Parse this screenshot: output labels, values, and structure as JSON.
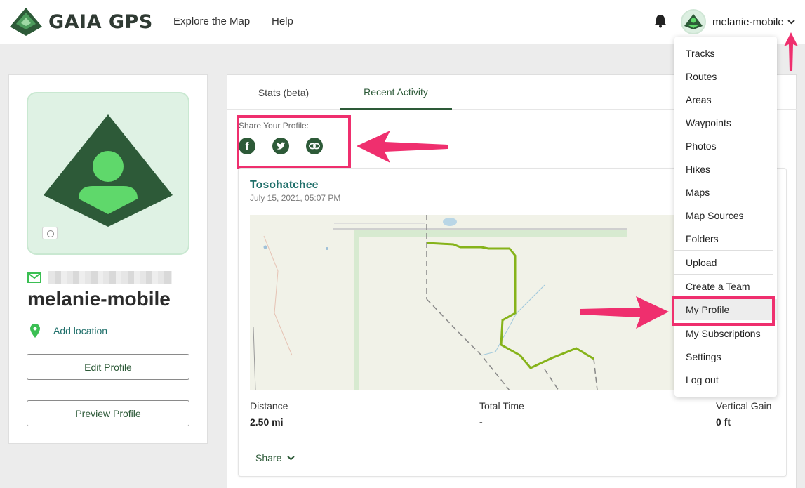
{
  "header": {
    "brand": "GAIA GPS",
    "nav": [
      "Explore the Map",
      "Help"
    ],
    "username": "melanie-mobile",
    "icons": {
      "notifications": "bell-icon",
      "menu": "chevron-down-icon"
    }
  },
  "profile": {
    "name": "melanie-mobile",
    "add_location": "Add location",
    "edit_button": "Edit Profile",
    "preview_button": "Preview Profile"
  },
  "tabs": [
    "Stats (beta)",
    "Recent Activity"
  ],
  "share_profile": {
    "label": "Share Your Profile:",
    "icons": [
      "facebook-icon",
      "twitter-icon",
      "link-icon"
    ]
  },
  "activity": {
    "title": "Tosohatchee",
    "date": "July 15, 2021, 05:07 PM",
    "stats": [
      {
        "label": "Distance",
        "value": "2.50 mi"
      },
      {
        "label": "Total Time",
        "value": "-"
      },
      {
        "label": "Vertical Gain",
        "value": "0 ft"
      }
    ],
    "share": "Share"
  },
  "dropdown": {
    "items": [
      "Tracks",
      "Routes",
      "Areas",
      "Waypoints",
      "Photos",
      "Hikes",
      "Maps",
      "Map Sources",
      "Folders",
      "Upload",
      "Create a Team",
      "My Profile",
      "My Subscriptions",
      "Settings",
      "Log out"
    ],
    "selected": "My Profile"
  },
  "colors": {
    "brand_green": "#2d5a38",
    "accent_pink": "#ef2f6e",
    "link_teal": "#1f6f6a",
    "track": "#86b31a"
  }
}
